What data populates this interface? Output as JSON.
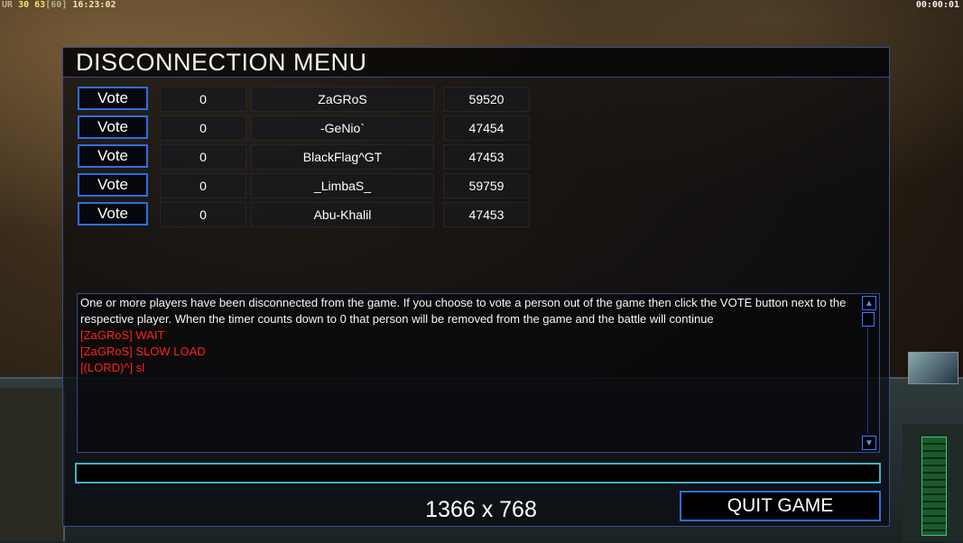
{
  "hud": {
    "top_left_prefix": "UR",
    "top_left_a": "30",
    "top_left_b": "63",
    "top_left_c": "[60]",
    "top_left_time": "16:23:02",
    "top_right_timer": "00:00:01"
  },
  "dialog": {
    "title": "DISCONNECTION MENU",
    "vote_label": "Vote",
    "players": [
      {
        "votes": "0",
        "name": "ZaGRoS",
        "ping": "59520"
      },
      {
        "votes": "0",
        "name": "-GeNio`",
        "ping": "47454"
      },
      {
        "votes": "0",
        "name": "BlackFlag^GT",
        "ping": "47453"
      },
      {
        "votes": "0",
        "name": "_LimbaS_",
        "ping": "59759"
      },
      {
        "votes": "0",
        "name": "Abu-Khalil",
        "ping": "47453"
      }
    ],
    "chat": {
      "system_message": "One or more players have been disconnected from the game. If you choose to vote a person out of the game then click the VOTE button next to the respective player. When the timer counts down to 0 that person will be removed from the game and the battle will continue",
      "messages": [
        "[ZaGRoS] WAIT",
        "[ZaGRoS] SLOW LOAD",
        "[(LORD)^] sl"
      ]
    },
    "chat_input_value": "",
    "resolution": "1366 x 768",
    "quit_label": "QUIT GAME"
  },
  "colors": {
    "button_border": "#2d6fe0",
    "chat_red": "#ff2020",
    "input_border": "#43b0c8"
  }
}
